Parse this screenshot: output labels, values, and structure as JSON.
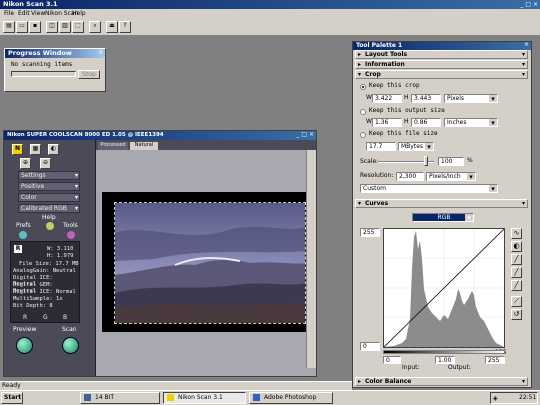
{
  "app": {
    "title": "Nikon Scan 3.1"
  },
  "menu": [
    "File",
    "Edit",
    "View",
    "Nikon Scan",
    "Help"
  ],
  "progress": {
    "title": "Progress Window",
    "status": "No scanning items",
    "stop": "Stop"
  },
  "scanner": {
    "title": "Nikon SUPER COOLSCAN 8000 ED 1.05 @ IEEE1394",
    "tabs": [
      "Processed",
      "Natural"
    ],
    "dropdowns": [
      "Settings",
      "Positive",
      "Color",
      "Calibrated RGB"
    ],
    "help": "Help",
    "prefs": "Prefs",
    "tools": "Tools",
    "info_r": "R",
    "info": [
      "W: 3.110",
      "H: 1.979",
      "File Size: 17.7 MB",
      "AnalogGain: Neutral",
      "Digital ICE: Neutral",
      "Digital GEM: Neutral",
      "Digital ICE: Normal",
      "MultiSample: 1x",
      "Bit Depth: 8"
    ],
    "rgb": [
      "R",
      "G",
      "B"
    ],
    "preview": "Preview",
    "scan": "Scan"
  },
  "palette": {
    "title": "Tool Palette 1",
    "sections": {
      "layout": "Layout Tools",
      "information": "Information",
      "crop": "Crop",
      "curves": "Curves",
      "color_balance": "Color Balance"
    },
    "crop": {
      "keep_crop": "Keep this crop",
      "w_label": "W",
      "w_value": "3.422",
      "h_label": "H",
      "h_value": "3.443",
      "units1": "Pixels",
      "keep_output": "Keep this output size",
      "ow_label": "W",
      "ow_value": "1.36",
      "oh_label": "H",
      "oh_value": "0.86",
      "units2": "Inches",
      "keep_file": "Keep this file size",
      "file_value": "17.7",
      "file_units": "MBytes",
      "scale_label": "Scale:",
      "scale_value": "100",
      "scale_pct": "%",
      "res_label": "Resolution:",
      "res_value": "2,300",
      "res_units": "Pixels/Inch",
      "preset": "Custom"
    },
    "curves": {
      "channel": "RGB",
      "top": "255",
      "bottom_left": "0",
      "bottom_right": "255",
      "input_low": "0",
      "gamma": "1.00",
      "input_high": "255",
      "input_label": "Input:",
      "output_label": "Output:"
    },
    "tool_icons": [
      "curve-icon",
      "contrast-icon",
      "eyedropper-black-icon",
      "eyedropper-gray-icon",
      "eyedropper-white-icon",
      "auto-contrast-icon",
      "reset-icon"
    ]
  },
  "status": {
    "text": "Ready"
  },
  "taskbar": {
    "start": "Start",
    "items": [
      "14 BIT",
      "Nikon Scan 3.1",
      "Adobe Photoshop"
    ],
    "clock": "22:51"
  },
  "colors": {
    "titlebar": "#0a246a",
    "face": "#d4d0c8",
    "desktop": "#808080",
    "scanner_body": "#4a4a58"
  }
}
